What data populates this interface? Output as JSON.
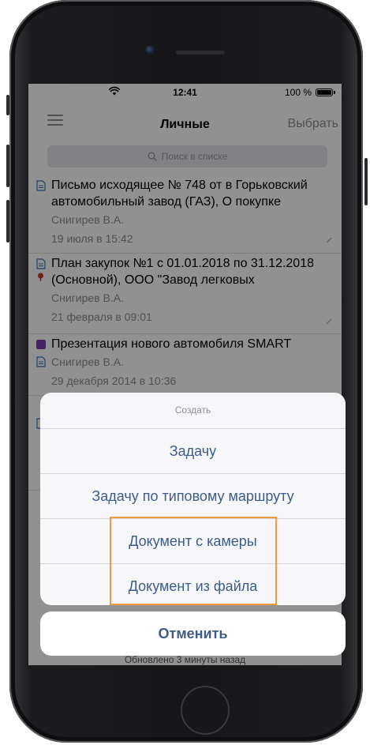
{
  "status_bar": {
    "time": "12:41",
    "battery": "100 %"
  },
  "navbar": {
    "title": "Личные",
    "select_label": "Выбрать"
  },
  "search": {
    "placeholder": "Поиск в списке"
  },
  "list": {
    "items": [
      {
        "title": "Письмо исходящее № 748 от  в Горьковский автомобильный завод (ГАЗ),  О покупке",
        "author": "Снигирев В.А.",
        "date": "19 июля в 15:42"
      },
      {
        "title": "План закупок №1 с 01.01.2018 по 31.12.2018 (Основной), ООО \"Завод легковых",
        "author": "Снигирев В.А.",
        "date": "21 февраля в 09:01"
      },
      {
        "title": "Презентация нового автомобиля SMART",
        "author": "Снигирев В.А.",
        "date": "29 декабря 2014 в 10:36"
      }
    ]
  },
  "footer": {
    "status": "Обновлено 3 минуты назад"
  },
  "action_sheet": {
    "header": "Создать",
    "options": [
      "Задачу",
      "Задачу по типовому маршруту",
      "Документ с камеры",
      "Документ из файла"
    ],
    "cancel_label": "Отменить"
  },
  "colors": {
    "accent": "#3d5c8a",
    "highlight": "#f39a3d",
    "tag_purple": "#7b3fb0",
    "flag_red": "#c0392b"
  },
  "icons": [
    "wifi-icon",
    "battery-icon",
    "menu-icon",
    "search-icon",
    "document-icon",
    "flag-icon",
    "pin-icon"
  ]
}
